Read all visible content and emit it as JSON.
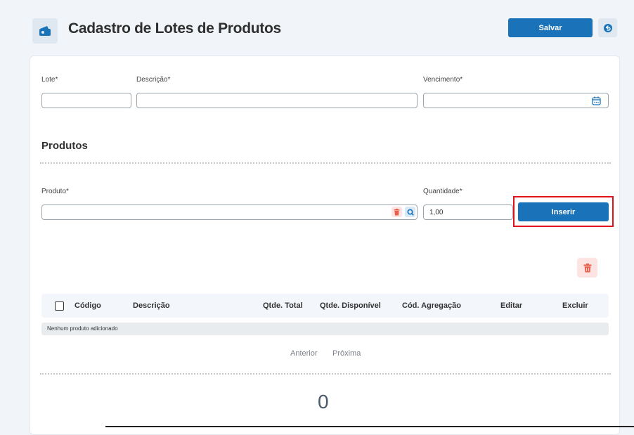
{
  "header": {
    "title": "Cadastro de Lotes de Produtos",
    "save_label": "Salvar",
    "icon": "wallet-icon",
    "back_icon": "undo-icon"
  },
  "form": {
    "lote_label": "Lote*",
    "lote_value": "",
    "descricao_label": "Descrição*",
    "descricao_value": "",
    "vencimento_label": "Vencimento*",
    "vencimento_value": "",
    "calendar_icon": "calendar-icon"
  },
  "produtos": {
    "section_title": "Produtos",
    "produto_label": "Produto*",
    "produto_value": "",
    "quantidade_label": "Quantidade*",
    "quantidade_value": "1,00",
    "insert_label": "Inserir"
  },
  "table": {
    "columns": [
      "Código",
      "Descrição",
      "Qtde. Total",
      "Qtde. Disponível",
      "Cód. Agregação",
      "Editar",
      "Excluir"
    ],
    "empty_message": "Nenhum produto adicionado"
  },
  "pagination": {
    "previous": "Anterior",
    "next": "Próxima"
  },
  "summary": {
    "total": "0"
  },
  "colors": {
    "primary": "#1a73b8",
    "danger": "#e8604c",
    "highlight": "#e0131d"
  }
}
